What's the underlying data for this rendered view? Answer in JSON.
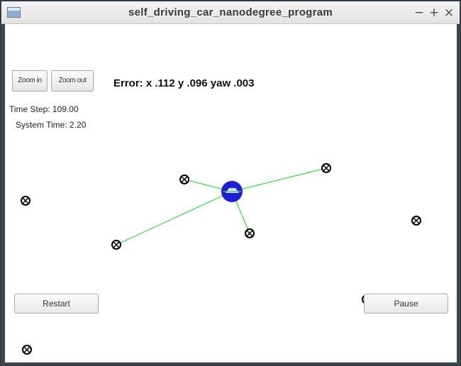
{
  "window": {
    "title": "self_driving_car_nanodegree_program",
    "controls": {
      "minimize": "−",
      "maximize": "+",
      "close": "×"
    }
  },
  "toolbar": {
    "zoom_in_label": "Zoom in",
    "zoom_out_label": "Zoom out"
  },
  "status": {
    "error_text": "Error: x .112 y .096 yaw .003",
    "time_step": "Time Step: 109.00",
    "system_time": "System Time: 2.20"
  },
  "buttons": {
    "restart_label": "Restart",
    "pause_label": "Pause"
  },
  "colors": {
    "car_fill": "#1f1fd6",
    "observation_line": "#33dd44",
    "landmark_stroke": "#000000"
  }
}
